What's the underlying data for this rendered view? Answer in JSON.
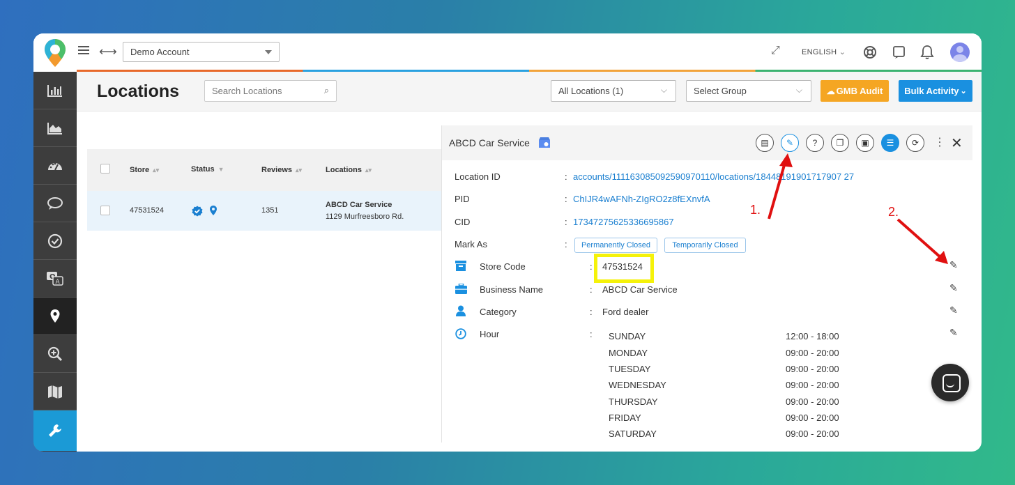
{
  "topbar": {
    "account": "Demo Account",
    "language": "ENGLISH"
  },
  "header": {
    "title": "Locations",
    "search_placeholder": "Search Locations",
    "locations_filter": "All Locations (1)",
    "group_filter": "Select Group",
    "gmb_audit": "GMB Audit",
    "bulk_activity": "Bulk Activity"
  },
  "table": {
    "headers": [
      "Store",
      "Status",
      "Reviews",
      "Locations"
    ],
    "row": {
      "store": "47531524",
      "reviews": "1351",
      "location_name": "ABCD Car Service",
      "location_address": "1129 Murfreesboro Rd."
    }
  },
  "panel": {
    "title": "ABCD Car Service",
    "location_id_label": "Location ID",
    "location_id": "accounts/111163085092590970110/locations/18448191901717907 27",
    "pid_label": "PID",
    "pid": "ChIJR4wAFNh-ZIgRO2z8fEXnvfA",
    "cid_label": "CID",
    "cid": "17347275625336695867",
    "mark_as_label": "Mark As",
    "permanently_closed": "Permanently Closed",
    "temporarily_closed": "Temporarily Closed",
    "store_code_label": "Store Code",
    "store_code": "47531524",
    "business_name_label": "Business Name",
    "business_name": "ABCD Car Service",
    "category_label": "Category",
    "category": "Ford dealer",
    "hour_label": "Hour",
    "hours": [
      {
        "day": "SUNDAY",
        "time": "12:00 - 18:00"
      },
      {
        "day": "MONDAY",
        "time": "09:00 - 20:00"
      },
      {
        "day": "TUESDAY",
        "time": "09:00 - 20:00"
      },
      {
        "day": "WEDNESDAY",
        "time": "09:00 - 20:00"
      },
      {
        "day": "THURSDAY",
        "time": "09:00 - 20:00"
      },
      {
        "day": "FRIDAY",
        "time": "09:00 - 20:00"
      },
      {
        "day": "SATURDAY",
        "time": "09:00 - 20:00"
      }
    ]
  },
  "annotations": {
    "step1": "1.",
    "step2": "2."
  },
  "colors": {
    "accent_blue": "#1a90e0",
    "audit_orange": "#f5a623",
    "highlight_yellow": "#f5f20a",
    "arrow_red": "#e01010"
  }
}
